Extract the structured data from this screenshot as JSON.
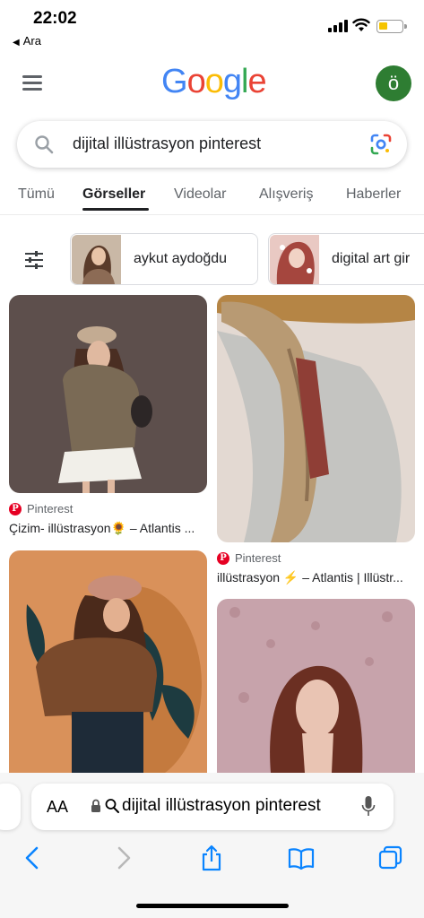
{
  "status_bar": {
    "time": "22:02",
    "back_label": "Ara"
  },
  "header": {
    "logo_letters": [
      "G",
      "o",
      "o",
      "g",
      "l",
      "e"
    ],
    "logo_colors": [
      "#4285F4",
      "#EA4335",
      "#FBBC05",
      "#4285F4",
      "#34A853",
      "#EA4335"
    ],
    "avatar_letter": "ö",
    "avatar_color": "#2e7d32"
  },
  "search": {
    "query": "dijital illüstrasyon pinterest"
  },
  "tabs": [
    {
      "label": "Tümü",
      "active": false
    },
    {
      "label": "Görseller",
      "active": true
    },
    {
      "label": "Videolar",
      "active": false
    },
    {
      "label": "Alışveriş",
      "active": false
    },
    {
      "label": "Haberler",
      "active": false
    }
  ],
  "chips": [
    {
      "label": "aykut aydoğdu"
    },
    {
      "label": "digital art gir"
    }
  ],
  "results": [
    {
      "source": "Pinterest",
      "caption": "Çizim- illüstrasyon🌻 – Atlantis ..."
    },
    {
      "source": "Pinterest",
      "caption": "illüstrasyon ⚡ – Atlantis | Illüstr..."
    }
  ],
  "browser": {
    "aa_label": "AA",
    "address_text": "dijital illüstrasyon pinterest"
  },
  "colors": {
    "pinterest_red": "#e60023",
    "ios_blue": "#0a84ff",
    "card1_bg": "#5d4f4c",
    "card3_bg": "#d9915a",
    "card4_bg": "#c7a3ab"
  }
}
